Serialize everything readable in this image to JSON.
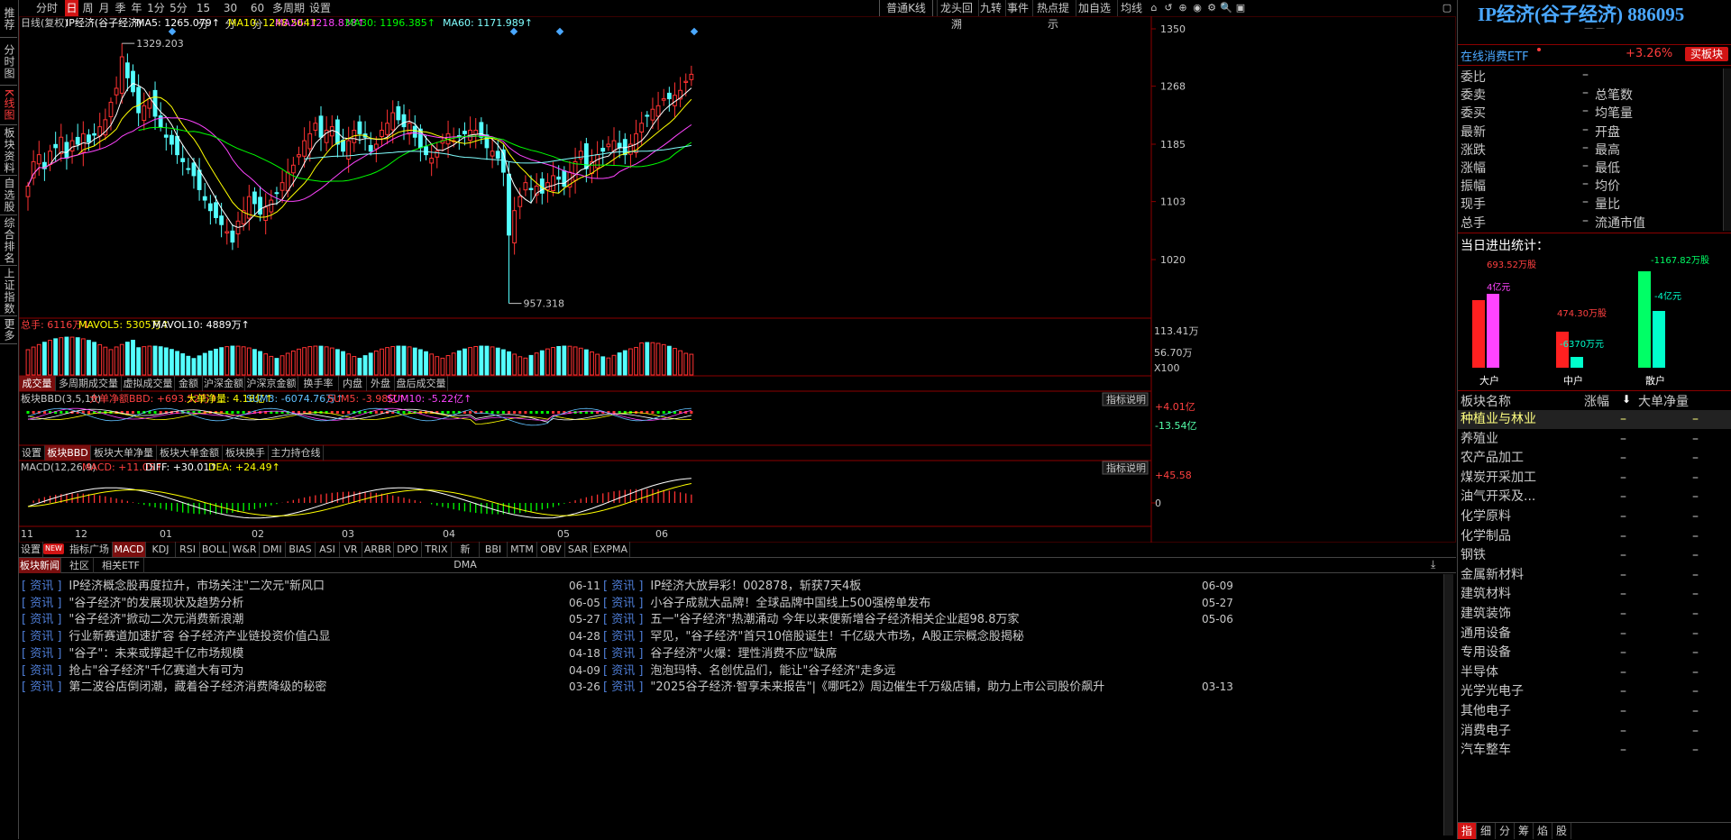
{
  "left_tabs": [
    "推荐",
    "分时图",
    "K线图",
    "板块资料",
    "自选股",
    "综合排名",
    "上证指数",
    "更多"
  ],
  "toolbar": {
    "left_items": [
      "分时",
      "日",
      "周",
      "月",
      "季",
      "年",
      "1分",
      "5分",
      "15分",
      "30分",
      "60分",
      "多周期",
      "设置"
    ],
    "selected": "日",
    "right_items": [
      "普通K线",
      "龙头回溯",
      "九转",
      "事件",
      "热点提示",
      "加自选",
      "均线"
    ],
    "icons": [
      "home-icon",
      "undo-icon",
      "zoom-icon",
      "view-icon",
      "settings-icon",
      "search-icon",
      "window-icon"
    ]
  },
  "kline": {
    "title": "日线(复权)",
    "stock": "IP经济(谷子经济)",
    "ma": [
      {
        "label": "MA5: 1265.079↑",
        "color": "#ffffff"
      },
      {
        "label": "MA10: 1248.564↑",
        "color": "#ffff00"
      },
      {
        "label": "MA20: 1218.838↑",
        "color": "#ff44ff"
      },
      {
        "label": "MA30: 1196.385↑",
        "color": "#00ff00"
      },
      {
        "label": "MA60: 1171.989↑",
        "color": "#80ffff"
      }
    ],
    "price_ticks": [
      "1350",
      "1268",
      "1185",
      "1103",
      "1020"
    ],
    "high_label": "1329.203",
    "low_label": "957.318"
  },
  "volume": {
    "label": "总手: 6116万↓",
    "mavol5": "MAVOL5: 5305万↑",
    "mavol10": "MAVOL10: 4889万↑",
    "ticks": [
      "113.41万",
      "56.70万",
      "X100"
    ],
    "tabs": [
      "成交量",
      "多周期成交量",
      "虚拟成交量",
      "金额",
      "沪深金额",
      "沪深京金额",
      "换手率",
      "内盘",
      "外盘",
      "盘后成交量"
    ]
  },
  "bbd": {
    "label": "板块BBD(3,5,10)",
    "parts": [
      {
        "text": "大单净额BBD: +693.52万↑",
        "color": "#ff4040"
      },
      {
        "text": "大单净量: 4.18亿↑",
        "color": "#ffff00"
      },
      {
        "text": "SUM3: -6074.76万↑",
        "color": "#60c0ff"
      },
      {
        "text": "SUM5: -3.98亿↑",
        "color": "#ff4040"
      },
      {
        "text": "SUM10: -5.22亿↑",
        "color": "#ff44ff"
      }
    ],
    "explain": "指标说明",
    "ticks": [
      "4.01亿",
      "-13.54亿"
    ],
    "tabs": [
      "设置",
      "板块BBD",
      "板块大单净量",
      "板块大单金额",
      "板块换手",
      "主力持仓线"
    ]
  },
  "macd": {
    "label": "MACD(12,26,9)",
    "parts": [
      {
        "text": "MACD: +11.05↑",
        "color": "#ff4040"
      },
      {
        "text": "DIFF: +30.01↑",
        "color": "#ffffff"
      },
      {
        "text": "DEA: +24.49↑",
        "color": "#ffff00"
      }
    ],
    "explain": "指标说明",
    "ticks": [
      "45.58",
      "0"
    ],
    "months": [
      "11",
      "12",
      "01",
      "02",
      "03",
      "04",
      "05",
      "06"
    ],
    "tabs": [
      "设置",
      "指标广场",
      "MACD",
      "KDJ",
      "RSI",
      "BOLL",
      "W&R",
      "DMI",
      "BIAS",
      "ASI",
      "VR",
      "ARBR",
      "DPO",
      "TRIX",
      "新DMA",
      "BBI",
      "MTM",
      "OBV",
      "SAR",
      "EXPMA"
    ],
    "new_badge": "NEW"
  },
  "news": {
    "tabs": [
      "板块新闻",
      "社区",
      "相关ETF"
    ],
    "tag": "资讯",
    "left": [
      {
        "title": "IP经济概念股再度拉升，市场关注\"二次元\"新风口",
        "date": "06-11"
      },
      {
        "title": "\"谷子经济\"的发展现状及趋势分析",
        "date": "06-05"
      },
      {
        "title": "\"谷子经济\"掀动二次元消费新浪潮",
        "date": "05-27"
      },
      {
        "title": "行业新赛道加速扩容 谷子经济产业链投资价值凸显",
        "date": "04-28"
      },
      {
        "title": "\"谷子\"：未来或撑起千亿市场规模",
        "date": "04-18"
      },
      {
        "title": "抢占\"谷子经济\"千亿赛道大有可为",
        "date": "04-09"
      },
      {
        "title": "第二波谷店倒闭潮，藏着谷子经济消费降级的秘密",
        "date": "03-26"
      }
    ],
    "right": [
      {
        "title": "IP经济大放异彩！002878，斩获7天4板",
        "date": "06-09"
      },
      {
        "title": "小谷子成就大品牌！全球品牌中国线上500强榜单发布",
        "date": "05-27"
      },
      {
        "title": "五一\"谷子经济\"热潮涌动 今年以来便新增谷子经济相关企业超98.8万家",
        "date": "05-06"
      },
      {
        "title": "罕见，\"谷子经济\"首只10倍股诞生！千亿级大市场，A股正宗概念股揭秘",
        "date": ""
      },
      {
        "title": "谷子经济\"火爆：理性消费不应\"缺席",
        "date": ""
      },
      {
        "title": "泡泡玛特、名创优品们，能让\"谷子经济\"走多远",
        "date": ""
      },
      {
        "title": "\"2025谷子经济·智享未来报告\"|《哪吒2》周边催生千万级店铺，助力上市公司股价飙升",
        "date": "03-13"
      }
    ]
  },
  "right_panel": {
    "title": "IP经济(谷子经济) 886095",
    "subtitle": "— —",
    "etf_name": "在线消费ETF",
    "etf_change": "+3.26%",
    "buy_etf": "买板块",
    "stats": [
      [
        "委比",
        "–",
        "",
        ""
      ],
      [
        "委卖",
        "–",
        "总笔数",
        ""
      ],
      [
        "委买",
        "–",
        "均笔量",
        ""
      ],
      [
        "最新",
        "–",
        "开盘",
        ""
      ],
      [
        "涨跌",
        "–",
        "最高",
        ""
      ],
      [
        "涨幅",
        "–",
        "最低",
        ""
      ],
      [
        "振幅",
        "–",
        "均价",
        ""
      ],
      [
        "现手",
        "–",
        "量比",
        ""
      ],
      [
        "总手",
        "–",
        "流通市值",
        ""
      ]
    ],
    "flow_title": "当日进出统计：",
    "flow": [
      {
        "name": "大户",
        "top": "693.52万股",
        "mid": "4亿元"
      },
      {
        "name": "中户",
        "top": "474.30万股",
        "mid": "-6370万元"
      },
      {
        "name": "散户",
        "top": "-1167.82万股",
        "mid": "-4亿元"
      }
    ],
    "sector_header": [
      "板块名称",
      "涨幅",
      "大单净量"
    ],
    "sectors": [
      "种植业与林业",
      "养殖业",
      "农产品加工",
      "煤炭开采加工",
      "油气开采及...",
      "化学原料",
      "化学制品",
      "钢铁",
      "金属新材料",
      "建筑材料",
      "建筑装饰",
      "通用设备",
      "专用设备",
      "半导体",
      "光学光电子",
      "其他电子",
      "消费电子",
      "汽车整车"
    ],
    "bottom_tabs": [
      "指",
      "细",
      "分",
      "筹",
      "焰",
      "股"
    ]
  },
  "chart_data": {
    "type": "candlestick",
    "title": "IP经济(谷子经济) 日线(复权)",
    "ylim": [
      957.318,
      1350
    ],
    "ohlc_high": 1329.203,
    "ohlc_low": 957.318,
    "x_months": [
      "11",
      "12",
      "01",
      "02",
      "03",
      "04",
      "05",
      "06"
    ],
    "closes": [
      1125,
      1160,
      1170,
      1150,
      1175,
      1180,
      1195,
      1165,
      1190,
      1185,
      1200,
      1188,
      1198,
      1210,
      1220,
      1245,
      1265,
      1310,
      1280,
      1260,
      1230,
      1240,
      1250,
      1225,
      1210,
      1195,
      1185,
      1170,
      1160,
      1150,
      1140,
      1120,
      1105,
      1090,
      1080,
      1070,
      1060,
      1045,
      1075,
      1090,
      1110,
      1100,
      1085,
      1095,
      1105,
      1115,
      1130,
      1145,
      1155,
      1170,
      1190,
      1200,
      1215,
      1195,
      1205,
      1210,
      1185,
      1175,
      1190,
      1205,
      1200,
      1195,
      1175,
      1185,
      1205,
      1215,
      1230,
      1220,
      1210,
      1215,
      1195,
      1180,
      1170,
      1165,
      1175,
      1190,
      1200,
      1190,
      1195,
      1200,
      1205,
      1205,
      1195,
      1180,
      1175,
      1165,
      1145,
      1055,
      1090,
      1110,
      1130,
      1120,
      1125,
      1115,
      1130,
      1140,
      1135,
      1125,
      1145,
      1160,
      1175,
      1150,
      1160,
      1170,
      1175,
      1185,
      1190,
      1180,
      1170,
      1185,
      1200,
      1215,
      1225,
      1235,
      1240,
      1250,
      1250,
      1255,
      1262,
      1275,
      1285
    ]
  }
}
